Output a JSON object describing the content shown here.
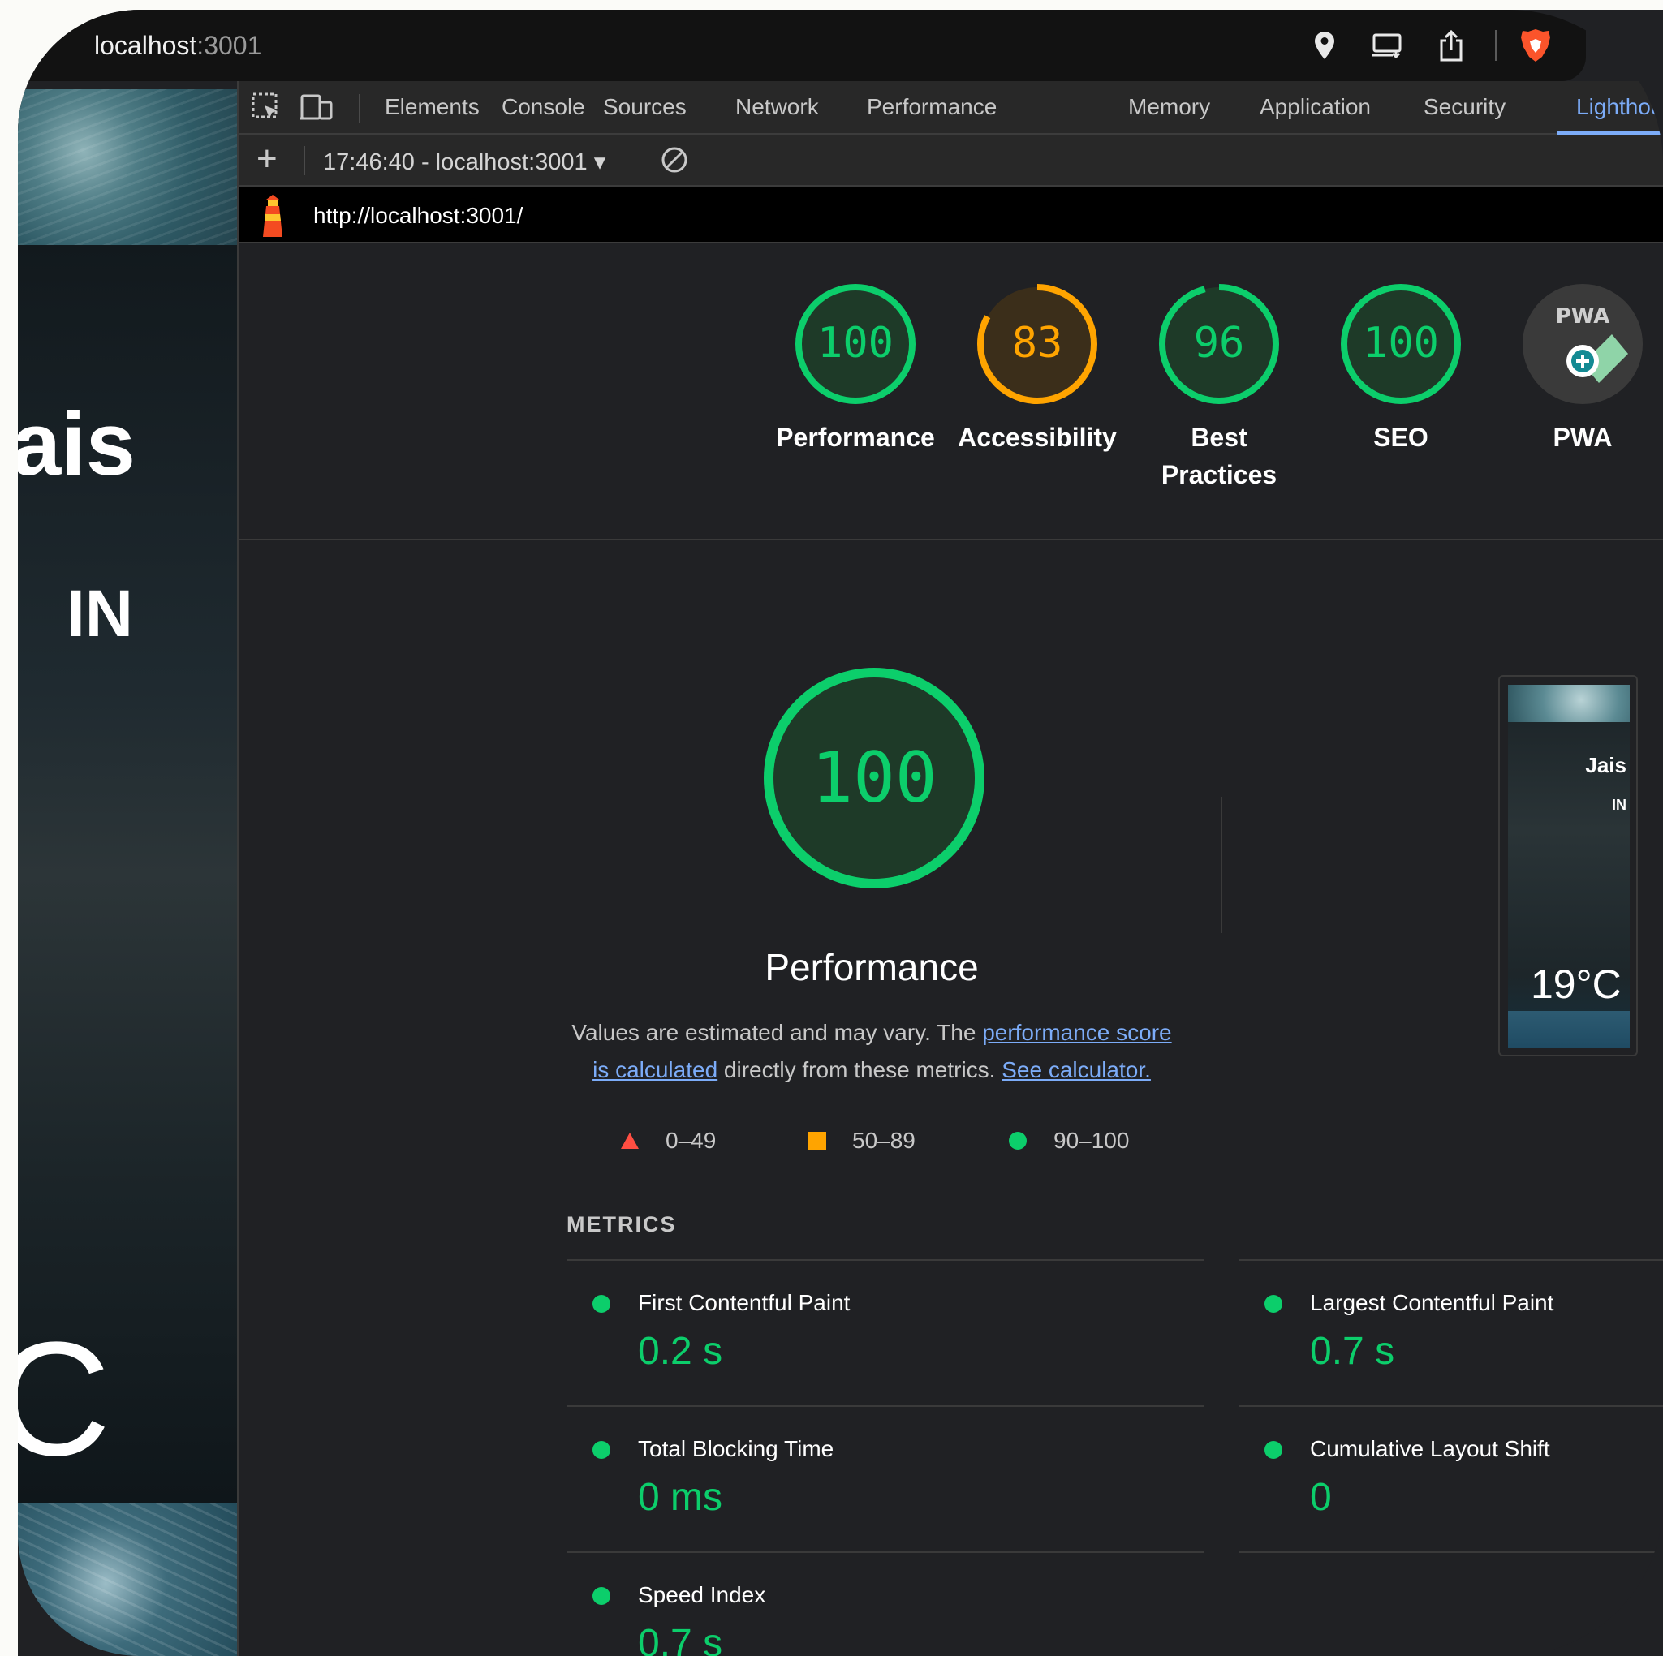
{
  "browser": {
    "host": "localhost",
    "port": ":3001",
    "icons": [
      "location-pin-icon",
      "cast-icon",
      "share-icon",
      "brave-shield-icon"
    ]
  },
  "page_preview": {
    "city_fragment": "ais",
    "country": "IN",
    "temp_fragment": "C"
  },
  "devtools": {
    "tabs": [
      "Elements",
      "Console",
      "Sources",
      "Network",
      "Performance",
      "Memory",
      "Application",
      "Security",
      "Lighthous"
    ],
    "active_tab": "Lighthous",
    "report_select": "17:46:40 - localhost:3001 ▾",
    "report_url": "http://localhost:3001/"
  },
  "categories": [
    {
      "label": "Performance",
      "score": "100",
      "value": 100,
      "color": "#0cce6b",
      "bg": "#1e3a28"
    },
    {
      "label": "Accessibility",
      "score": "83",
      "value": 83,
      "color": "#ffa400",
      "bg": "#3b2e1a"
    },
    {
      "label": "Best Practices",
      "score": "96",
      "value": 96,
      "color": "#0cce6b",
      "bg": "#1e3a28"
    },
    {
      "label": "SEO",
      "score": "100",
      "value": 100,
      "color": "#0cce6b",
      "bg": "#1e3a28"
    },
    {
      "label": "PWA",
      "badge": "PWA"
    }
  ],
  "performance": {
    "score": "100",
    "title": "Performance",
    "desc_1": "Values are estimated and may vary. The ",
    "link_1": "performance score is calculated",
    "desc_2": " directly from these metrics. ",
    "link_2": "See calculator."
  },
  "legend": [
    {
      "range": "0–49",
      "shape": "triangle",
      "color": "#ff4e42"
    },
    {
      "range": "50–89",
      "shape": "square",
      "color": "#ffa400"
    },
    {
      "range": "90–100",
      "shape": "circle",
      "color": "#0cce6b"
    }
  ],
  "screenshot": {
    "city": "Jais",
    "country": "IN",
    "temp": "19°C"
  },
  "metrics": {
    "heading": "METRICS",
    "items": [
      {
        "name": "First Contentful Paint",
        "value": "0.2 s"
      },
      {
        "name": "Largest Contentful Paint",
        "value": "0.7 s"
      },
      {
        "name": "Total Blocking Time",
        "value": "0 ms"
      },
      {
        "name": "Cumulative Layout Shift",
        "value": "0"
      },
      {
        "name": "Speed Index",
        "value": "0.7 s"
      }
    ]
  }
}
